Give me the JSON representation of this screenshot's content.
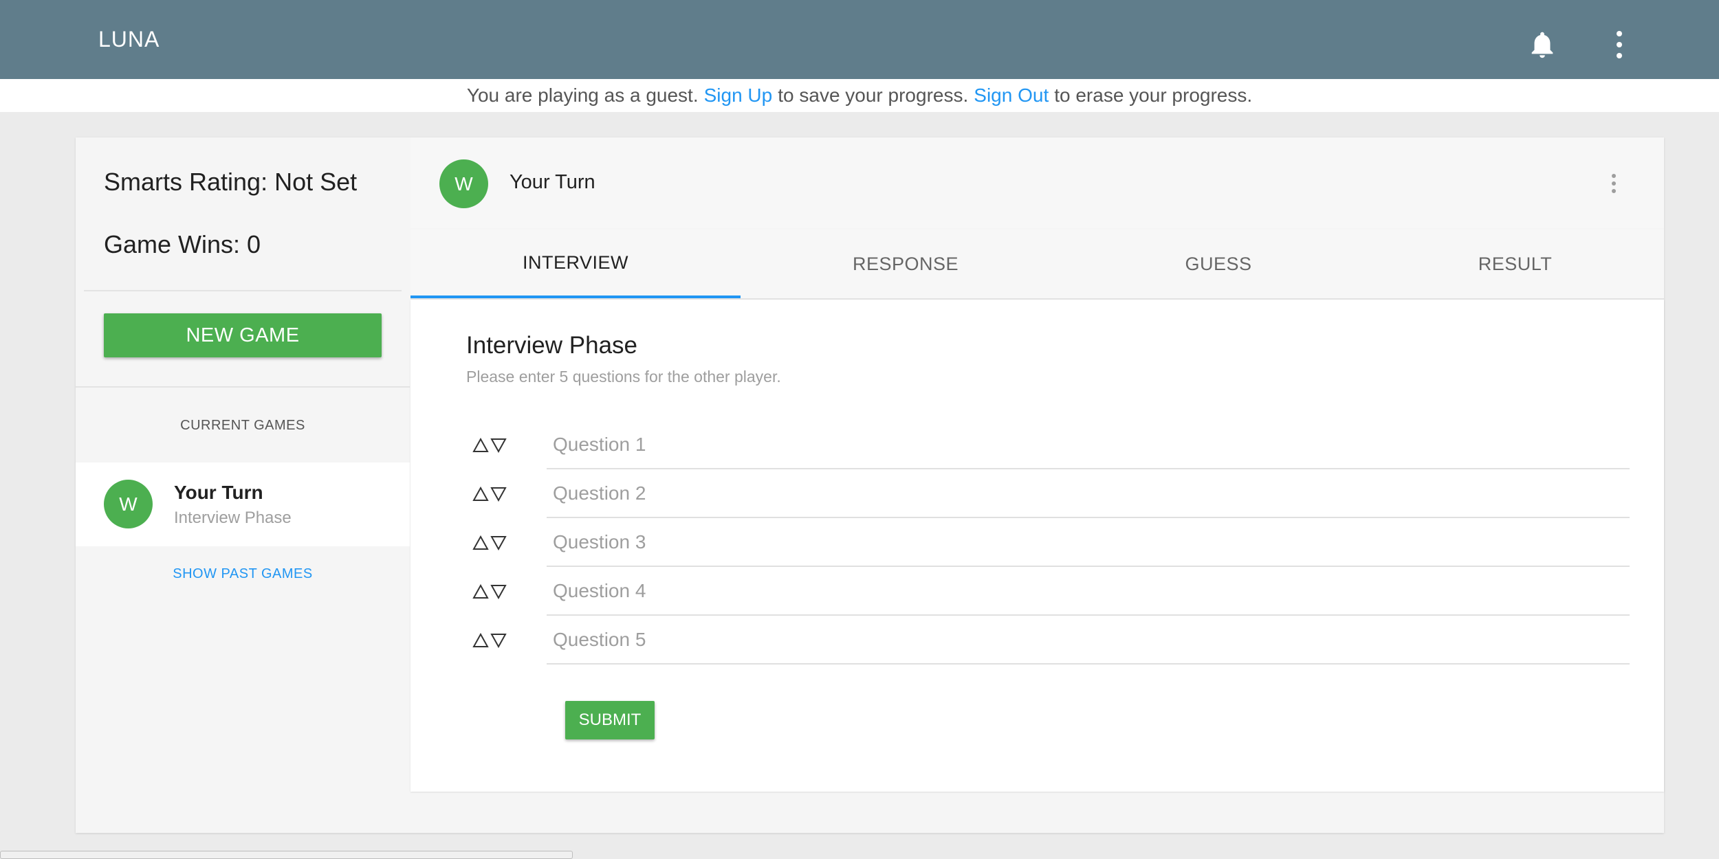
{
  "app": {
    "title": "LUNA",
    "bell_icon": "bell-icon",
    "menu_icon": "more-vert-icon"
  },
  "banner": {
    "prefix": "You are playing as a guest.",
    "sign_up": "Sign Up",
    "middle": "to save your progress.",
    "sign_out": "Sign Out",
    "suffix": "to erase your progress."
  },
  "sidebar": {
    "smarts_rating": "Smarts Rating: Not Set",
    "game_wins": "Game Wins: 0",
    "new_game_label": "NEW GAME",
    "current_games_label": "CURRENT GAMES",
    "games": [
      {
        "avatar_letter": "W",
        "title": "Your Turn",
        "subtitle": "Interview Phase"
      }
    ],
    "show_past_label": "SHOW PAST GAMES"
  },
  "game": {
    "avatar_letter": "W",
    "header_title": "Your Turn",
    "tabs": [
      {
        "label": "INTERVIEW",
        "active": true
      },
      {
        "label": "RESPONSE",
        "active": false
      },
      {
        "label": "GUESS",
        "active": false
      },
      {
        "label": "RESULT",
        "active": false
      }
    ],
    "phase_title": "Interview Phase",
    "phase_subtitle": "Please enter 5 questions for the other player.",
    "questions": [
      {
        "placeholder": "Question 1",
        "value": ""
      },
      {
        "placeholder": "Question 2",
        "value": ""
      },
      {
        "placeholder": "Question 3",
        "value": ""
      },
      {
        "placeholder": "Question 4",
        "value": ""
      },
      {
        "placeholder": "Question 5",
        "value": ""
      }
    ],
    "submit_label": "SUBMIT"
  },
  "colors": {
    "appbar": "#607d8b",
    "accent": "#2196f3",
    "green": "#4caf50"
  }
}
